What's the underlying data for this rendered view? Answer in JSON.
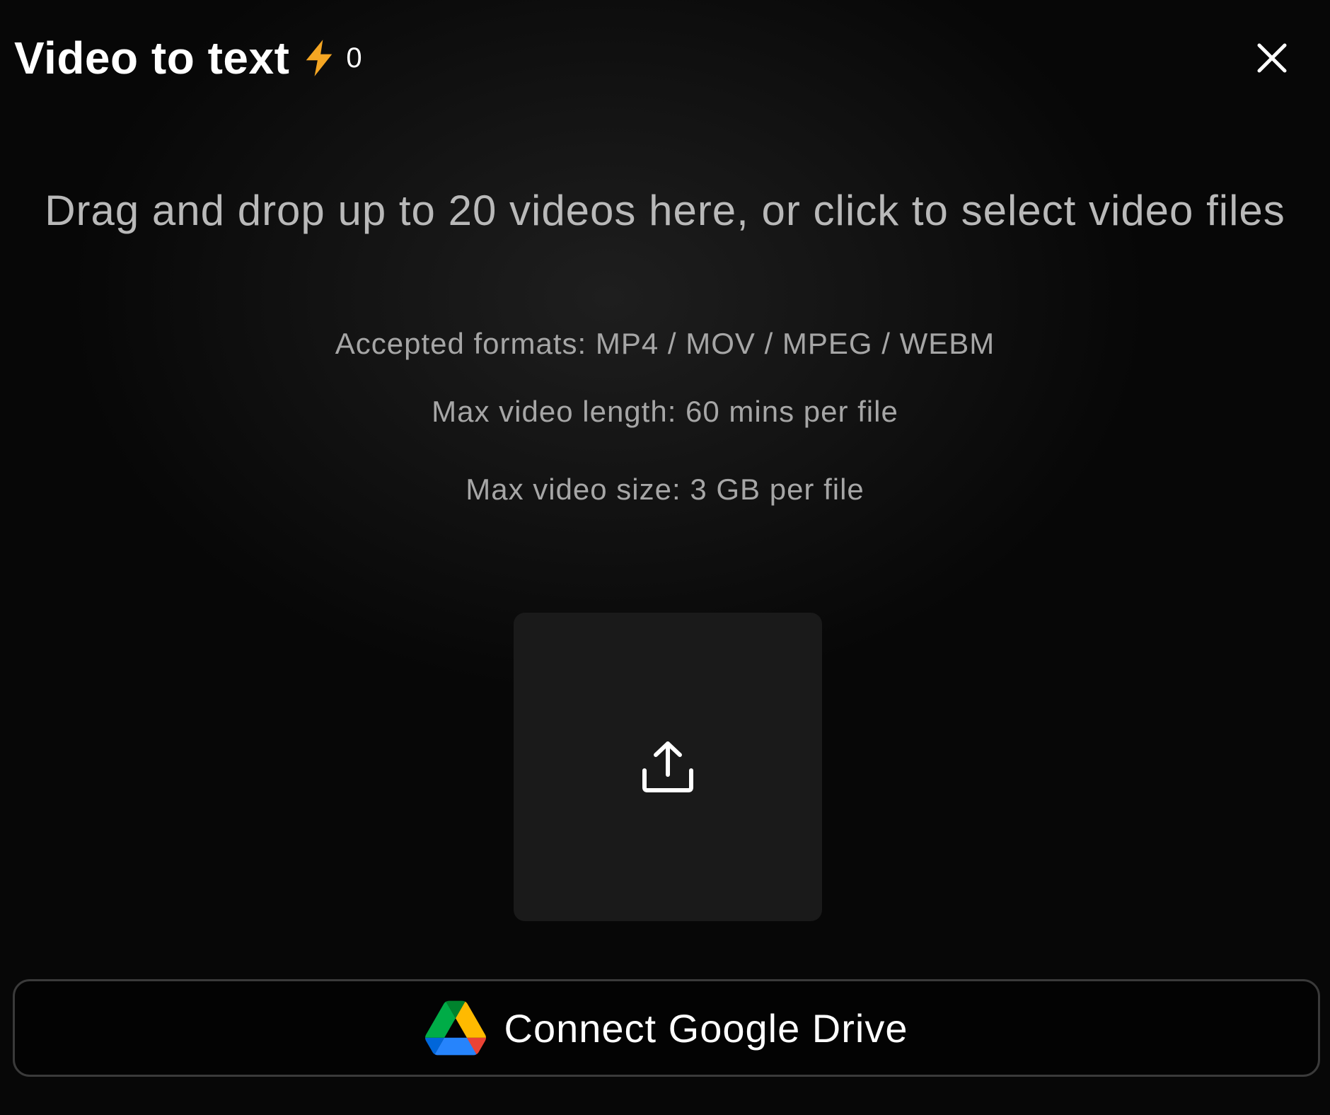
{
  "header": {
    "title": "Video to text",
    "credits": "0",
    "credit_icon": "lightning-bolt-icon",
    "credit_icon_color": "#f5a623",
    "close_icon": "close-icon"
  },
  "dropzone": {
    "headline": "Drag and drop up to 20 videos here, or click to select video files",
    "formats": "Accepted formats: MP4 / MOV / MPEG / WEBM",
    "max_length": "Max video length: 60 mins per file",
    "max_size": "Max video size: 3 GB per file",
    "upload_icon": "upload-icon"
  },
  "google_drive": {
    "label": "Connect Google Drive",
    "icon": "google-drive-icon",
    "colors": {
      "green": "#1fa463",
      "yellow": "#ffd04b",
      "blue": "#4688f4",
      "red": "#e94235"
    }
  }
}
